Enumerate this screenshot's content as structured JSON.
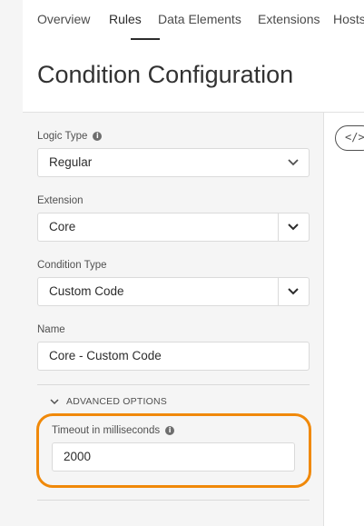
{
  "nav": {
    "tabs": [
      {
        "label": "Overview"
      },
      {
        "label": "Rules"
      },
      {
        "label": "Data Elements"
      },
      {
        "label": "Extensions"
      },
      {
        "label": "Hosts"
      }
    ]
  },
  "header": {
    "title": "Condition Configuration"
  },
  "form": {
    "logic_type": {
      "label": "Logic Type",
      "value": "Regular"
    },
    "extension": {
      "label": "Extension",
      "value": "Core"
    },
    "condition_type": {
      "label": "Condition Type",
      "value": "Custom Code"
    },
    "name": {
      "label": "Name",
      "value": "Core - Custom Code"
    },
    "advanced": {
      "label": "ADVANCED OPTIONS",
      "timeout": {
        "label": "Timeout in milliseconds",
        "value": "2000"
      }
    }
  },
  "code_button": {
    "label": "</>"
  },
  "colors": {
    "highlight": "#f0890a",
    "panel_bg": "#f5f5f5"
  },
  "icons": [
    "info-icon",
    "chevron-down-icon",
    "code-icon"
  ]
}
